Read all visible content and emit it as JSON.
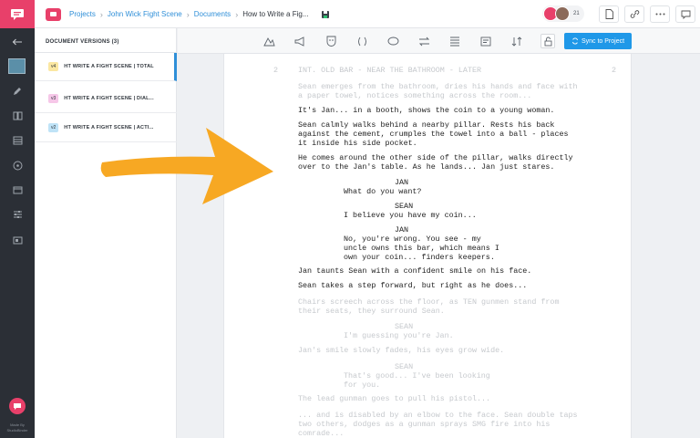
{
  "breadcrumb": {
    "projects": "Projects",
    "project": "John Wick Fight Scene",
    "documents": "Documents",
    "current": "How to Write a Fig..."
  },
  "collaborators": {
    "count_label": "21"
  },
  "versions_panel": {
    "title": "DOCUMENT VERSIONS (3)",
    "items": [
      {
        "tag": "v4",
        "label": "HT WRITE A FIGHT SCENE | TOTAL",
        "tag_color": "#fbe7a1"
      },
      {
        "tag": "v3",
        "label": "HT WRITE A FIGHT SCENE | DIAL...",
        "tag_color": "#f6c7e8"
      },
      {
        "tag": "v2",
        "label": "HT WRITE A FIGHT SCENE | ACTI...",
        "tag_color": "#bfe3f7"
      }
    ]
  },
  "toolbar": {
    "sync_label": "Sync to Project"
  },
  "rail": {
    "credit": "Made By StudioBinder"
  },
  "script": {
    "page_number": "2",
    "lines": [
      {
        "text": "INT. OLD BAR - NEAR THE BATHROOM - LATER",
        "style": "faded"
      },
      {
        "text": "Sean emerges from the bathroom, dries his hands and face with",
        "style": "faded"
      },
      {
        "text": "a paper towel, notices something across the room...",
        "style": "faded"
      },
      {
        "text": "It's Jan... in a booth, shows the coin to a young woman.",
        "style": "bold"
      },
      {
        "text": "Sean calmly walks behind a nearby pillar. Rests his back",
        "style": "bold"
      },
      {
        "text": "against the cement, crumples the towel into a ball - places",
        "style": "bold"
      },
      {
        "text": "it inside his side pocket.",
        "style": "bold"
      },
      {
        "text": "He comes around the other side of the pillar, walks directly",
        "style": "bold"
      },
      {
        "text": "over to the Jan's table. As he lands... Jan just stares.",
        "style": "bold"
      },
      {
        "text": "JAN",
        "style": "bold"
      },
      {
        "text": "What do you want?",
        "style": "bold"
      },
      {
        "text": "SEAN",
        "style": "bold"
      },
      {
        "text": "I believe you have my coin...",
        "style": "bold"
      },
      {
        "text": "JAN",
        "style": "bold"
      },
      {
        "text": "No, you're wrong. You see - my",
        "style": "bold"
      },
      {
        "text": "uncle owns this bar, which means I",
        "style": "bold"
      },
      {
        "text": "own your coin... finders keepers.",
        "style": "bold"
      },
      {
        "text": "Jan taunts Sean with a confident smile on his face.",
        "style": "bold"
      },
      {
        "text": "Sean takes a step forward, but right as he does...",
        "style": "bold"
      },
      {
        "text": "Chairs screech across the floor, as TEN gunmen stand from",
        "style": "faded"
      },
      {
        "text": "their seats, they surround Sean.",
        "style": "faded"
      },
      {
        "text": "SEAN",
        "style": "faded"
      },
      {
        "text": "I'm guessing you're Jan.",
        "style": "faded"
      },
      {
        "text": "Jan's smile slowly fades, his eyes grow wide.",
        "style": "faded"
      },
      {
        "text": "SEAN",
        "style": "faded"
      },
      {
        "text": "That's good... I've been looking",
        "style": "faded"
      },
      {
        "text": "for you.",
        "style": "faded"
      },
      {
        "text": "The lead gunman goes to pull his pistol...",
        "style": "faded"
      },
      {
        "text": "... and is disabled by an elbow to the face. Sean double taps",
        "style": "faded"
      },
      {
        "text": "two others, dodges as a gunman sprays SMG fire into his",
        "style": "faded"
      },
      {
        "text": "comrade...",
        "style": "faded"
      }
    ]
  },
  "colors": {
    "brand": "#e8406a",
    "accent": "#1f98e8",
    "arrow": "#f7a823"
  }
}
